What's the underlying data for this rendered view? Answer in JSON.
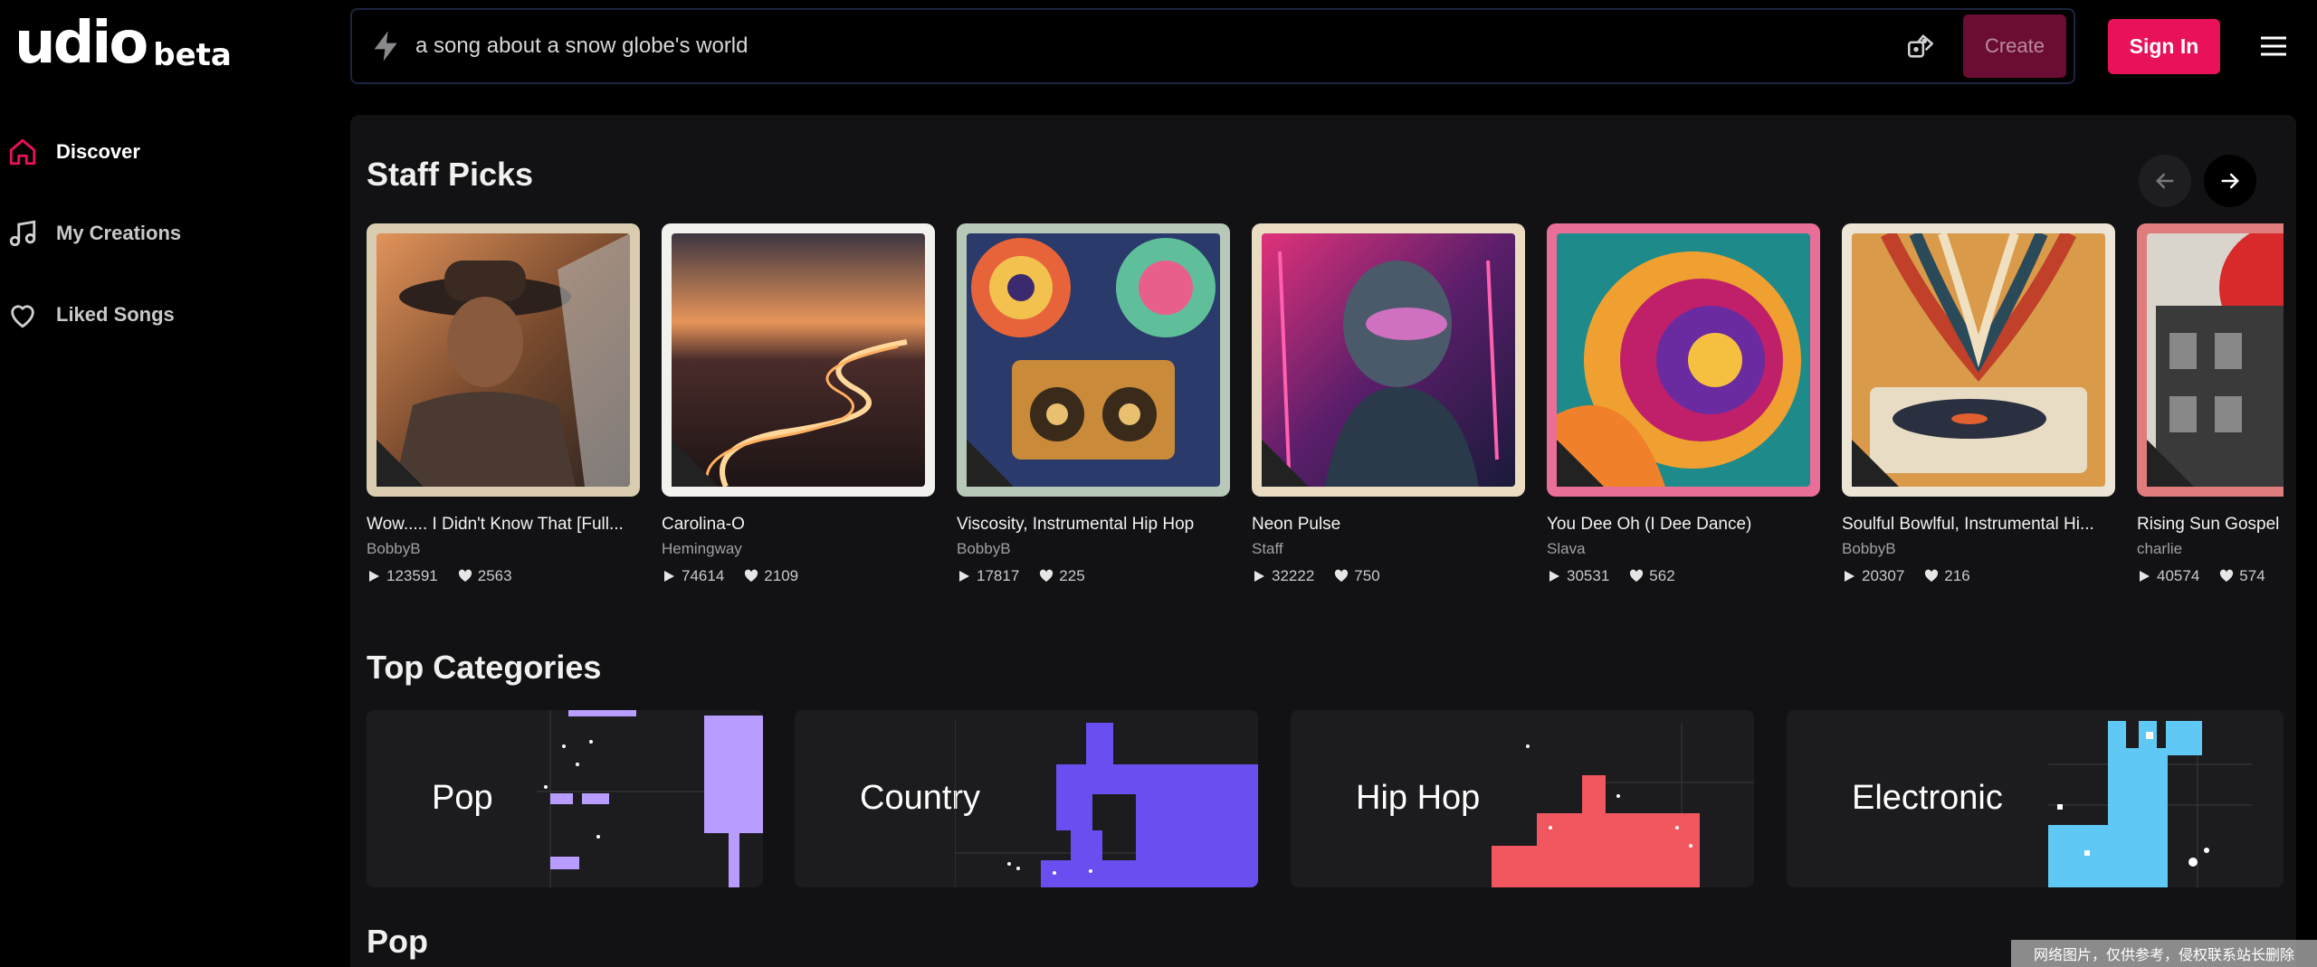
{
  "app": {
    "logo_text": "udio",
    "logo_badge": "beta"
  },
  "sidebar": {
    "items": [
      {
        "label": "Discover",
        "icon": "home-icon",
        "active": true
      },
      {
        "label": "My Creations",
        "icon": "music-note-icon",
        "active": false
      },
      {
        "label": "Liked Songs",
        "icon": "heart-icon",
        "active": false
      }
    ]
  },
  "prompt": {
    "placeholder": "a song about a snow globe's world",
    "create_label": "Create"
  },
  "header": {
    "signin_label": "Sign In"
  },
  "staff_picks": {
    "title": "Staff Picks",
    "songs": [
      {
        "title": "Wow..... I Didn't Know That [Full...",
        "artist": "BobbyB",
        "plays": "123591",
        "likes": "2563"
      },
      {
        "title": "Carolina-O",
        "artist": "Hemingway",
        "plays": "74614",
        "likes": "2109"
      },
      {
        "title": "Viscosity, Instrumental Hip Hop",
        "artist": "BobbyB",
        "plays": "17817",
        "likes": "225"
      },
      {
        "title": "Neon Pulse",
        "artist": "Staff",
        "plays": "32222",
        "likes": "750"
      },
      {
        "title": "You Dee Oh (I Dee Dance)",
        "artist": "Slava",
        "plays": "30531",
        "likes": "562"
      },
      {
        "title": "Soulful Bowlful, Instrumental Hi...",
        "artist": "BobbyB",
        "plays": "20307",
        "likes": "216"
      },
      {
        "title": "Rising Sun Gospel",
        "artist": "charlie",
        "plays": "40574",
        "likes": "574"
      }
    ]
  },
  "top_categories": {
    "title": "Top Categories",
    "items": [
      {
        "label": "Pop",
        "color": "#b99cff"
      },
      {
        "label": "Country",
        "color": "#6a4ef0"
      },
      {
        "label": "Hip Hop",
        "color": "#f2565f"
      },
      {
        "label": "Electronic",
        "color": "#5fc8f5"
      }
    ]
  },
  "pop_section": {
    "title": "Pop"
  },
  "watermark": "网络图片，仅供参考，侵权联系站长删除",
  "colors": {
    "accent": "#e8115a",
    "panel": "#121214"
  }
}
